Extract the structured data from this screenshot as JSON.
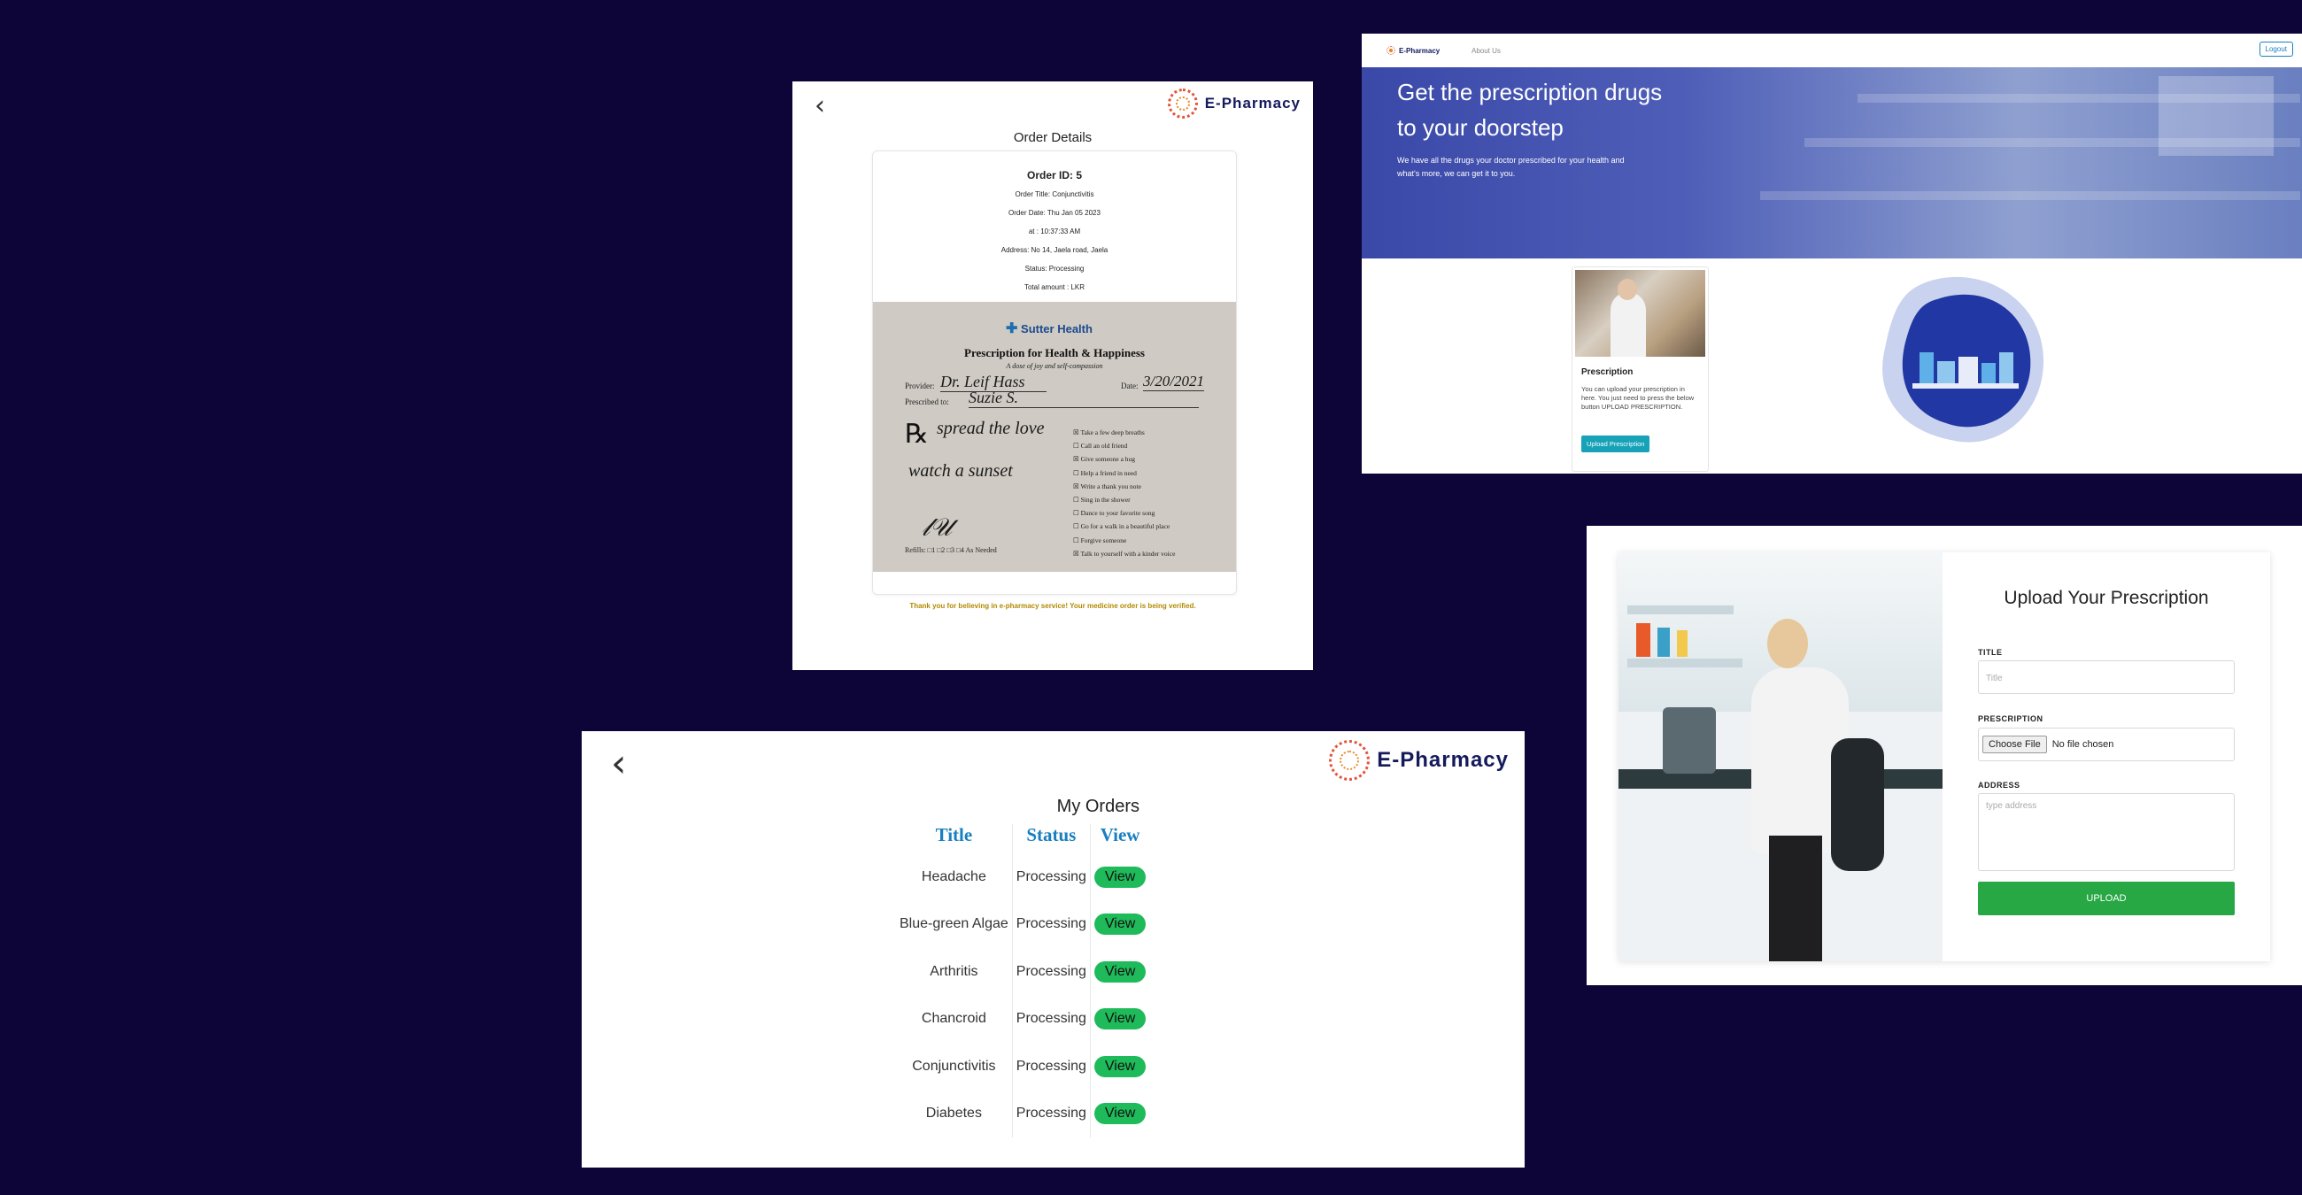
{
  "order_details": {
    "brand": "E-Pharmacy",
    "heading": "Order Details",
    "order_id": "Order ID: 5",
    "order_title": "Order Title: Conjunctivitis",
    "order_date": "Order Date: Thu Jan 05 2023",
    "order_time": "at : 10:37:33 AM",
    "address": "Address: No 14, Jaela road, Jaela",
    "status": "Status: Processing",
    "total_amount": "Total amount : LKR",
    "prescription_image": {
      "org": "Sutter Health",
      "title": "Prescription for Health & Happiness",
      "tagline": "A dose of joy and self-compassion",
      "provider_label": "Provider:",
      "provider": "Dr. Leif Hass",
      "date_label": "Date:",
      "date": "3/20/2021",
      "prescribed_label": "Prescribed to:",
      "prescribed_to": "Suzie S.",
      "rx_lines": [
        "spread the love",
        "watch a sunset"
      ],
      "refills": "Refills: □1 □2 □3 □4 As Needed",
      "checklist": [
        {
          "text": "Take a few deep breaths",
          "checked": true
        },
        {
          "text": "Call an old friend",
          "checked": false
        },
        {
          "text": "Give someone a hug",
          "checked": true
        },
        {
          "text": "Help a friend in need",
          "checked": false
        },
        {
          "text": "Write a thank you note",
          "checked": true
        },
        {
          "text": "Sing in the shower",
          "checked": false
        },
        {
          "text": "Dance to your favorite song",
          "checked": false
        },
        {
          "text": "Go for a walk in a beautiful place",
          "checked": false
        },
        {
          "text": "Forgive someone",
          "checked": false
        },
        {
          "text": "Talk to yourself with a kinder voice",
          "checked": true
        }
      ]
    },
    "thanks": "Thank you for believing in e-pharmacy service! Your medicine order is being verified."
  },
  "home": {
    "brand": "E-Pharmacy",
    "nav_about": "About Us",
    "logout": "Logout",
    "hero_line1": "Get the prescription drugs",
    "hero_line2": "to your doorstep",
    "hero_sub": "We have all the drugs your doctor prescribed for your health and what's more, we can get it to you.",
    "card_title": "Prescription",
    "card_text": "You can upload your prescription in here. You just need to press the below button UPLOAD PRESCRIPTION.",
    "card_button": "Upload Prescription"
  },
  "my_orders": {
    "brand": "E-Pharmacy",
    "heading": "My Orders",
    "columns": [
      "Title",
      "Status",
      "View"
    ],
    "rows": [
      {
        "title": "Headache",
        "status": "Processing",
        "action": "View"
      },
      {
        "title": "Blue-green Algae",
        "status": "Processing",
        "action": "View"
      },
      {
        "title": "Arthritis",
        "status": "Processing",
        "action": "View"
      },
      {
        "title": "Chancroid",
        "status": "Processing",
        "action": "View"
      },
      {
        "title": "Conjunctivitis",
        "status": "Processing",
        "action": "View"
      },
      {
        "title": "Diabetes",
        "status": "Processing",
        "action": "View"
      }
    ]
  },
  "upload": {
    "heading": "Upload Your Prescription",
    "title_label": "TITLE",
    "title_placeholder": "Title",
    "prescription_label": "PRESCRIPTION",
    "choose_file": "Choose File",
    "no_file": "No file chosen",
    "address_label": "ADDRESS",
    "address_placeholder": "type address",
    "submit": "UPLOAD"
  },
  "colors": {
    "background": "#0d0538",
    "brand_navy": "#151a5c",
    "accent_blue": "#1a7fc0",
    "view_green": "#1fba5a",
    "upload_green": "#28a745",
    "teal_button": "#17a2b8"
  }
}
